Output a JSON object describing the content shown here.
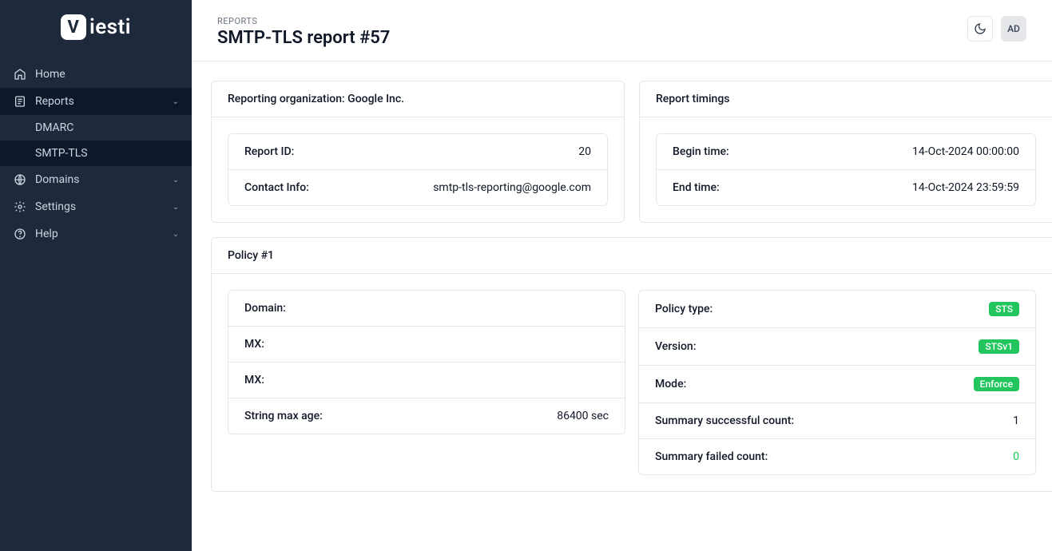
{
  "brand": "iesti",
  "sidebar": {
    "home": "Home",
    "reports": "Reports",
    "reports_sub": {
      "dmarc": "DMARC",
      "smtp_tls": "SMTP-TLS"
    },
    "domains": "Domains",
    "settings": "Settings",
    "help": "Help"
  },
  "header": {
    "breadcrumb": "REPORTS",
    "title": "SMTP-TLS report #57",
    "avatar_initials": "AD"
  },
  "org_card": {
    "title": "Reporting organization: Google Inc.",
    "report_id_label": "Report ID:",
    "report_id_value": "20",
    "contact_label": "Contact Info:",
    "contact_value": "smtp-tls-reporting@google.com"
  },
  "timings_card": {
    "title": "Report timings",
    "begin_label": "Begin time:",
    "begin_value": "14-Oct-2024 00:00:00",
    "end_label": "End time:",
    "end_value": "14-Oct-2024 23:59:59"
  },
  "policy_card": {
    "title": "Policy #1",
    "left": {
      "domain_label": "Domain:",
      "domain_value": "",
      "mx1_label": "MX:",
      "mx1_value": "",
      "mx2_label": "MX:",
      "mx2_value": "",
      "maxage_label": "String max age:",
      "maxage_value": "86400 sec"
    },
    "right": {
      "type_label": "Policy type:",
      "type_value": "STS",
      "version_label": "Version:",
      "version_value": "STSv1",
      "mode_label": "Mode:",
      "mode_value": "Enforce",
      "success_label": "Summary successful count:",
      "success_value": "1",
      "failed_label": "Summary failed count:",
      "failed_value": "0"
    }
  }
}
